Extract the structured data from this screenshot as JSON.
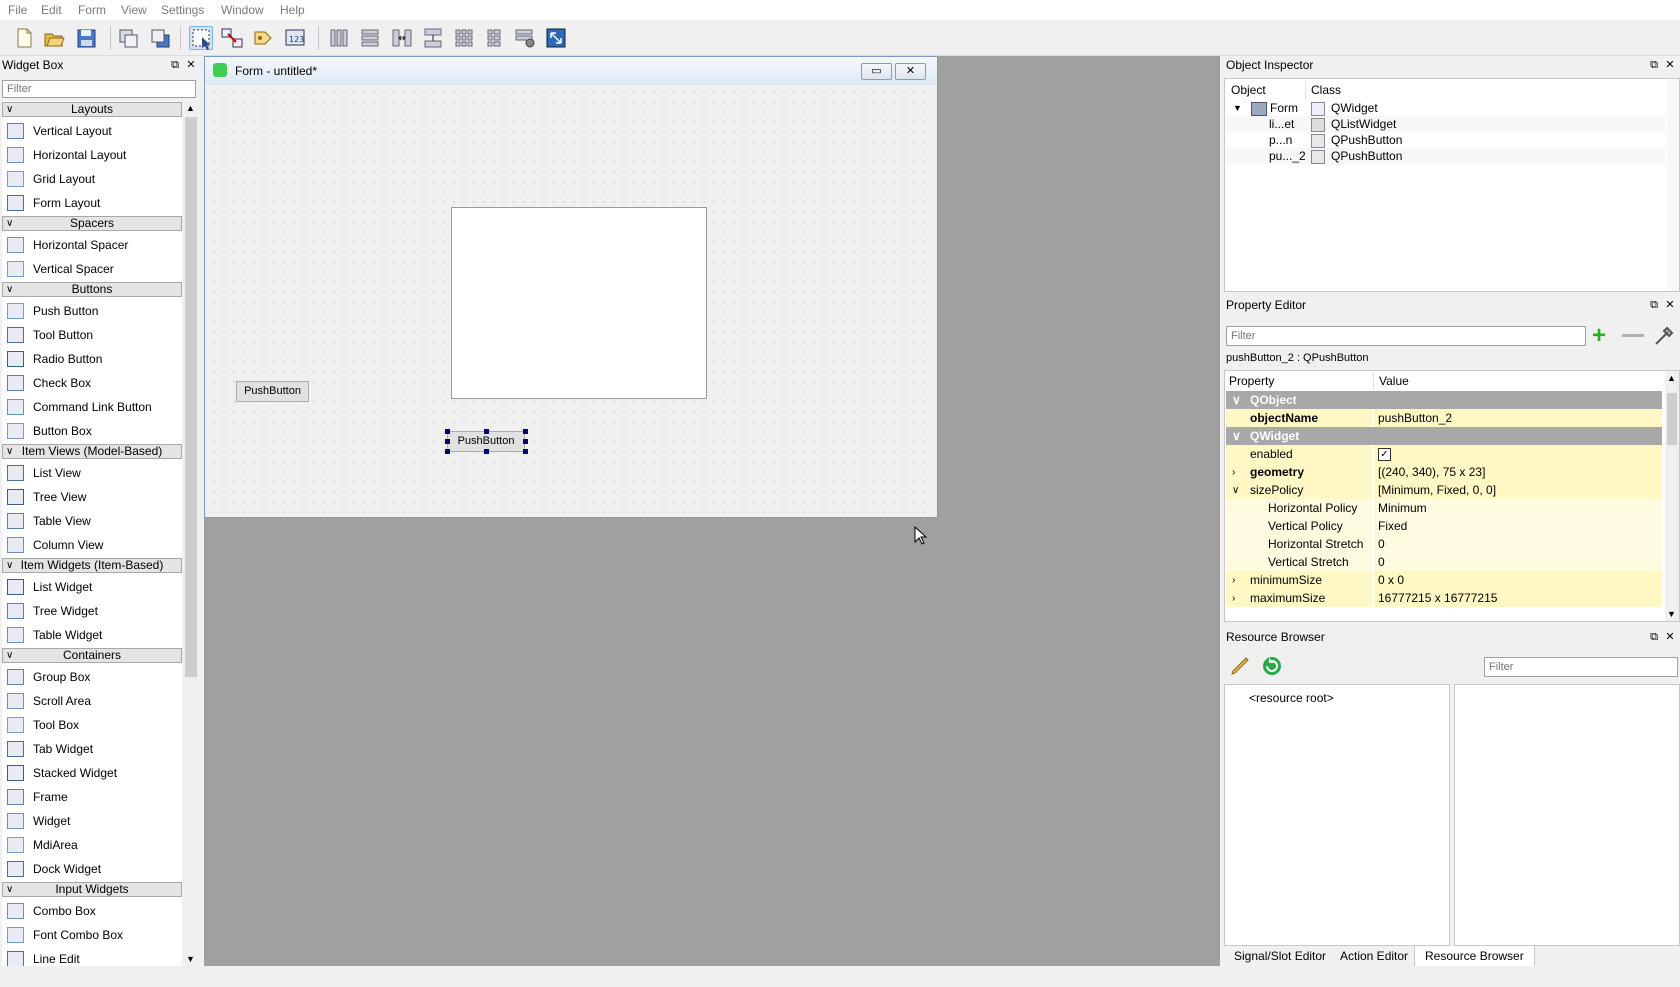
{
  "menu": [
    "File",
    "Edit",
    "Form",
    "View",
    "Settings",
    "Window",
    "Help"
  ],
  "widget_box": {
    "title": "Widget Box",
    "filter_placeholder": "Filter",
    "categories": [
      {
        "name": "Layouts",
        "items": [
          "Vertical Layout",
          "Horizontal Layout",
          "Grid Layout",
          "Form Layout"
        ]
      },
      {
        "name": "Spacers",
        "items": [
          "Horizontal Spacer",
          "Vertical Spacer"
        ]
      },
      {
        "name": "Buttons",
        "items": [
          "Push Button",
          "Tool Button",
          "Radio Button",
          "Check Box",
          "Command Link Button",
          "Button Box"
        ]
      },
      {
        "name": "Item Views (Model-Based)",
        "items": [
          "List View",
          "Tree View",
          "Table View",
          "Column View"
        ]
      },
      {
        "name": "Item Widgets (Item-Based)",
        "items": [
          "List Widget",
          "Tree Widget",
          "Table Widget"
        ]
      },
      {
        "name": "Containers",
        "items": [
          "Group Box",
          "Scroll Area",
          "Tool Box",
          "Tab Widget",
          "Stacked Widget",
          "Frame",
          "Widget",
          "MdiArea",
          "Dock Widget"
        ]
      },
      {
        "name": "Input Widgets",
        "items": [
          "Combo Box",
          "Font Combo Box",
          "Line Edit"
        ]
      }
    ]
  },
  "form": {
    "title": "Form - untitled*",
    "minimize_label": "▭",
    "close_label": "✕",
    "push_button_1": "PushButton",
    "push_button_2": "PushButton"
  },
  "object_inspector": {
    "title": "Object Inspector",
    "col_object": "Object",
    "col_class": "Class",
    "rows": [
      {
        "object": "Form",
        "class": "QWidget"
      },
      {
        "object": "li...et",
        "class": "QListWidget"
      },
      {
        "object": "p...n",
        "class": "QPushButton"
      },
      {
        "object": "pu..._2",
        "class": "QPushButton"
      }
    ]
  },
  "property_editor": {
    "title": "Property Editor",
    "filter_placeholder": "Filter",
    "subject": "pushButton_2 : QPushButton",
    "col_property": "Property",
    "col_value": "Value",
    "rows": [
      {
        "name": "QObject",
        "value": "",
        "kind": "group"
      },
      {
        "name": "objectName",
        "value": "pushButton_2",
        "kind": "bold"
      },
      {
        "name": "QWidget",
        "value": "",
        "kind": "group"
      },
      {
        "name": "enabled",
        "value": "",
        "kind": "check"
      },
      {
        "name": "geometry",
        "value": "[(240, 340), 75 x 23]",
        "kind": "bold-exp"
      },
      {
        "name": "sizePolicy",
        "value": "[Minimum, Fixed, 0, 0]",
        "kind": "open"
      },
      {
        "name": "Horizontal Policy",
        "value": "Minimum",
        "kind": "sub"
      },
      {
        "name": "Vertical Policy",
        "value": "Fixed",
        "kind": "sub"
      },
      {
        "name": "Horizontal Stretch",
        "value": "0",
        "kind": "sub"
      },
      {
        "name": "Vertical Stretch",
        "value": "0",
        "kind": "sub"
      },
      {
        "name": "minimumSize",
        "value": "0 x 0",
        "kind": "exp"
      },
      {
        "name": "maximumSize",
        "value": "16777215 x 16777215",
        "kind": "exp"
      }
    ]
  },
  "resource_browser": {
    "title": "Resource Browser",
    "filter_placeholder": "Filter",
    "root": "<resource root>"
  },
  "bottom_tabs": [
    "Signal/Slot Editor",
    "Action Editor",
    "Resource Browser"
  ]
}
